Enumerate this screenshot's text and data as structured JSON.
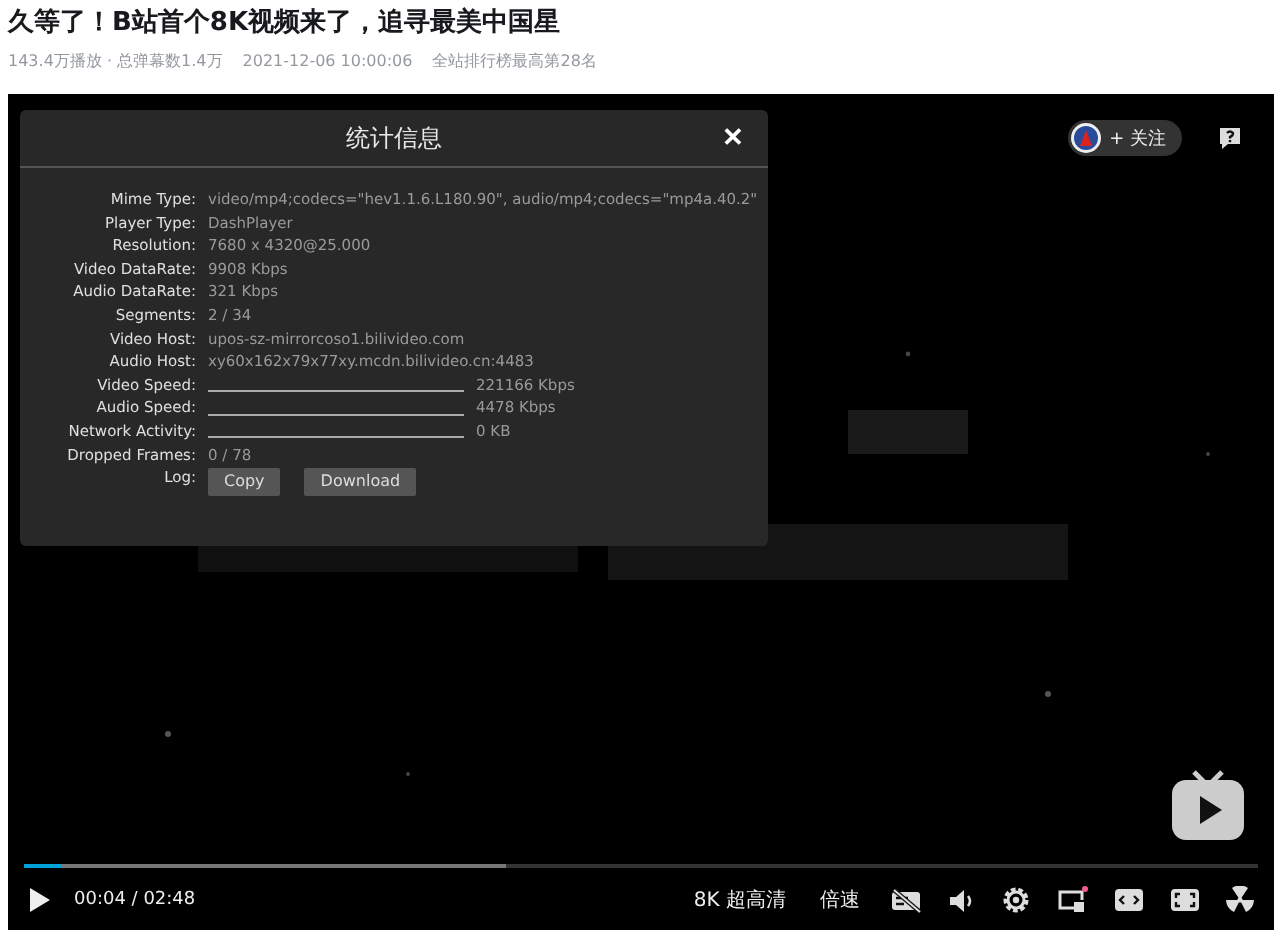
{
  "video": {
    "title": "久等了！B站首个8K视频来了，追寻最美中国星",
    "stats": [
      "143.4万播放 · 总弹幕数1.4万",
      "2021-12-06 10:00:06",
      "全站排行榜最高第28名"
    ]
  },
  "player": {
    "follow_button": "+ 关注",
    "stats_panel": {
      "title": "统计信息",
      "close": "✕",
      "rows": [
        {
          "kind": "text",
          "label": "Mime Type:",
          "value": "video/mp4;codecs=\"hev1.1.6.L180.90\", audio/mp4;codecs=\"mp4a.40.2\""
        },
        {
          "kind": "text",
          "label": "Player Type:",
          "value": "DashPlayer"
        },
        {
          "kind": "text",
          "label": "Resolution:",
          "value": "7680 x 4320@25.000"
        },
        {
          "kind": "text",
          "label": "Video DataRate:",
          "value": "9908 Kbps"
        },
        {
          "kind": "text",
          "label": "Audio DataRate:",
          "value": "321 Kbps"
        },
        {
          "kind": "text",
          "label": "Segments:",
          "value": "2 / 34"
        },
        {
          "kind": "text",
          "label": "Video Host:",
          "value": "upos-sz-mirrorcoso1.bilivideo.com"
        },
        {
          "kind": "text",
          "label": "Audio Host:",
          "value": "xy60x162x79x77xy.mcdn.bilivideo.cn:4483"
        },
        {
          "kind": "graph",
          "label": "Video Speed:",
          "value": "221166 Kbps"
        },
        {
          "kind": "graph",
          "label": "Audio Speed:",
          "value": "4478 Kbps"
        },
        {
          "kind": "graph",
          "label": "Network Activity:",
          "value": "0 KB"
        },
        {
          "kind": "text",
          "label": "Dropped Frames:",
          "value": "0 / 78"
        },
        {
          "kind": "buttons",
          "label": "Log:",
          "buttons": [
            "Copy",
            "Download"
          ]
        }
      ]
    },
    "progress": {
      "level": 0.03
    },
    "buffer": {
      "level": 0.39
    },
    "controls": {
      "time": "00:04 / 02:48",
      "quality": "8K 超高清",
      "speed": "倍速"
    }
  }
}
